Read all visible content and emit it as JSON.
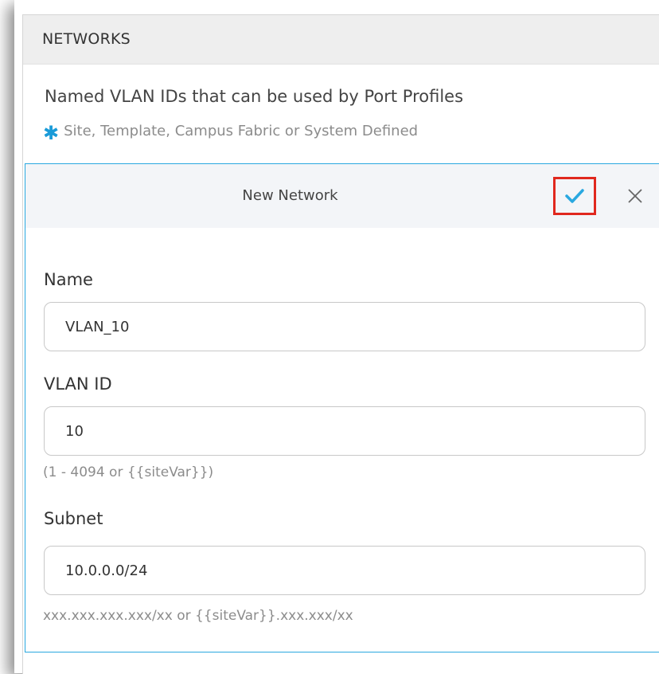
{
  "section": {
    "title": "NETWORKS",
    "description": "Named VLAN IDs that can be used by Port Profiles",
    "note_icon": "asterisk-icon",
    "note": "Site, Template, Campus Fabric or System Defined"
  },
  "panel": {
    "title": "New Network",
    "save_icon": "checkmark-icon",
    "close_icon": "close-icon",
    "fields": {
      "name": {
        "label": "Name",
        "value": "VLAN_10"
      },
      "vlan_id": {
        "label": "VLAN ID",
        "value": "10",
        "hint": "(1 - 4094 or {{siteVar}})"
      },
      "subnet": {
        "label": "Subnet",
        "value": "10.0.0.0/24",
        "hint": "xxx.xxx.xxx.xxx/xx or {{siteVar}}.xxx.xxx/xx"
      }
    }
  },
  "colors": {
    "accent": "#29a8e0",
    "highlight": "#e0281e",
    "header_bg": "#eeeeee"
  }
}
